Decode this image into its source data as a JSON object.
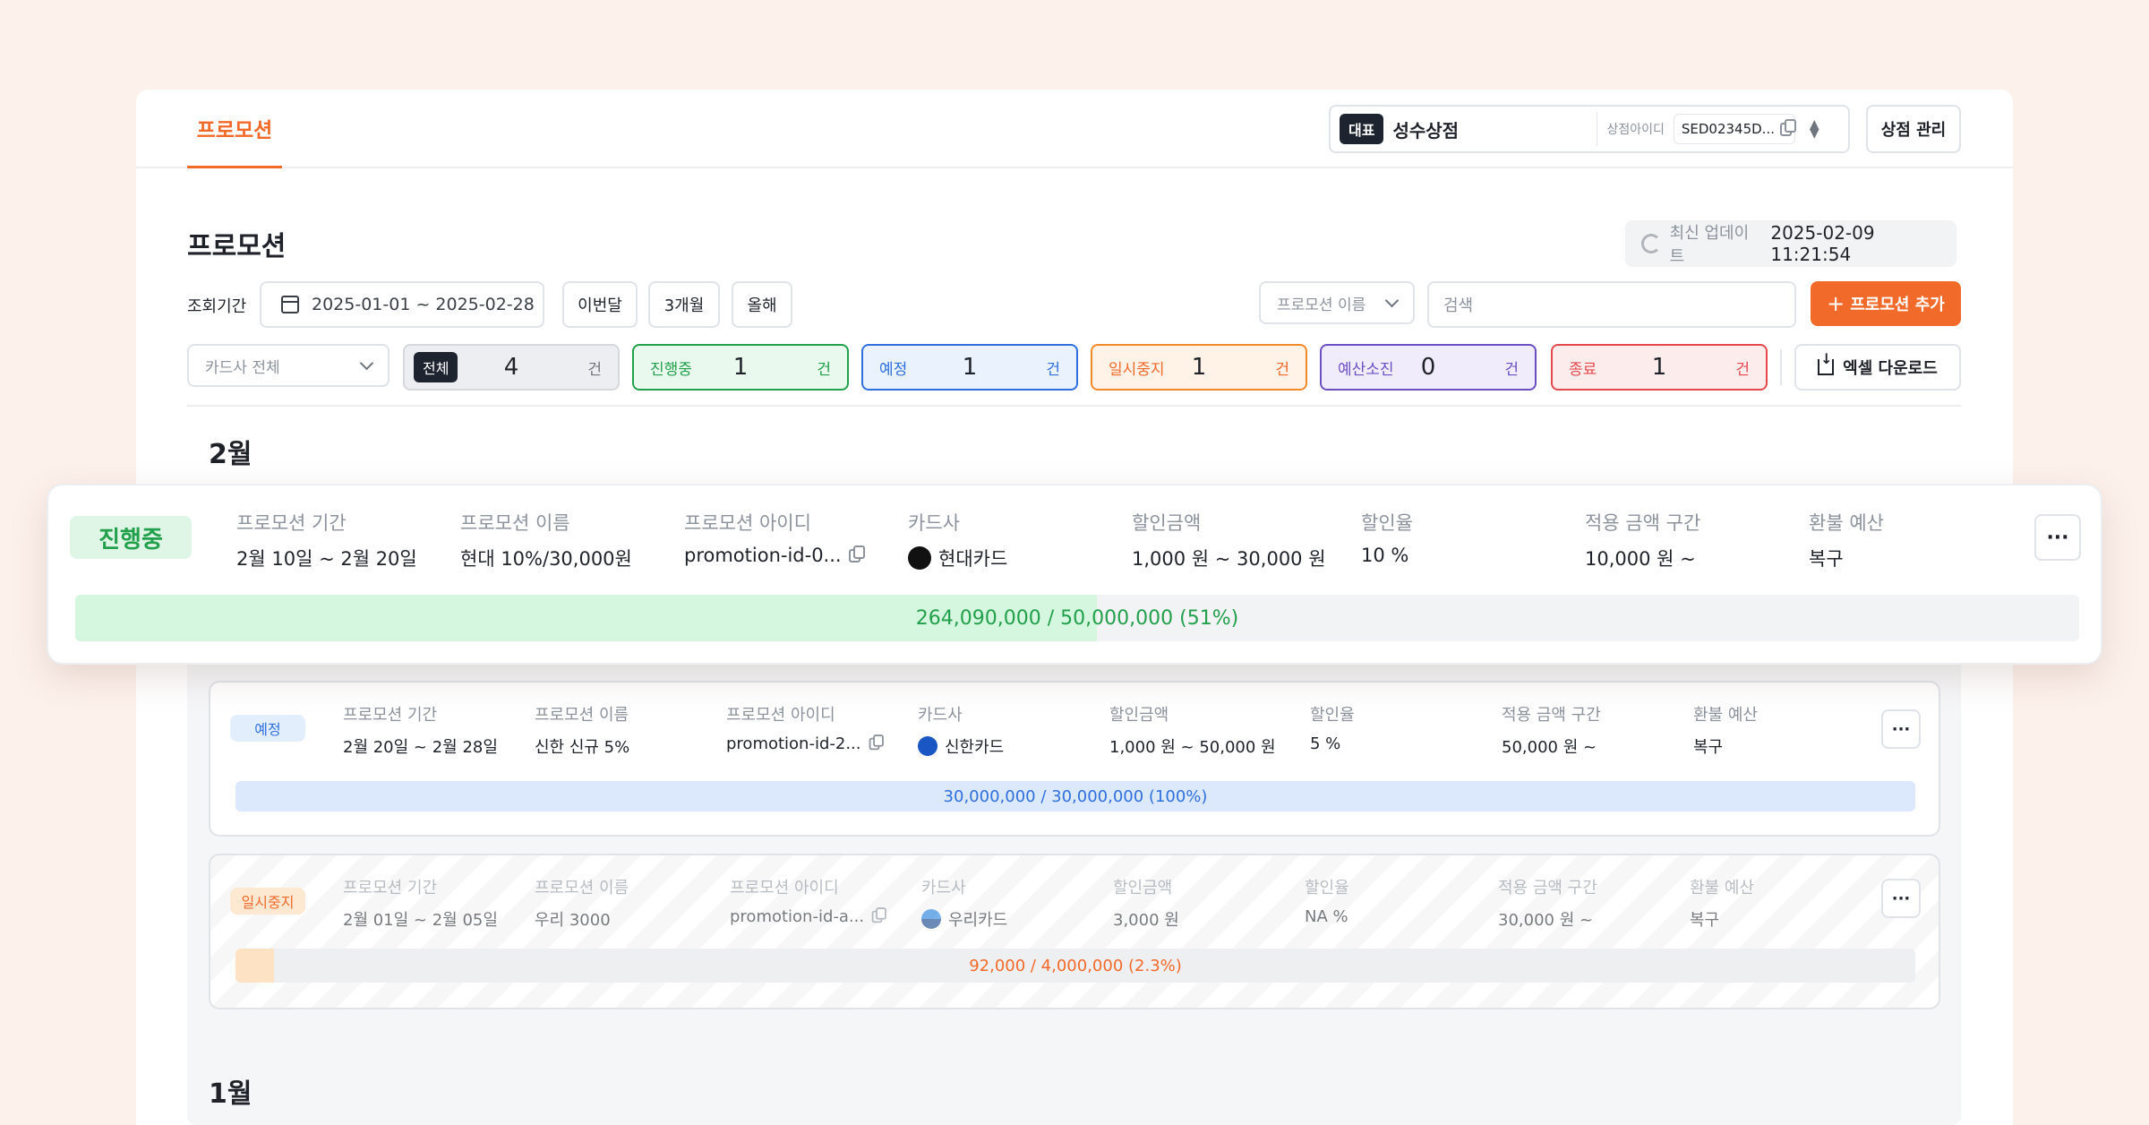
{
  "tab": {
    "active": "프로모션"
  },
  "store": {
    "badge": "대표",
    "name": "성수상점",
    "id_label": "상점아이디",
    "id": "SED02345D...",
    "manage_button": "상점 관리"
  },
  "page": {
    "title": "프로모션",
    "updated_label": "최신 업데이트",
    "updated_value": "2025-02-09 11:21:54"
  },
  "filters": {
    "period_label": "조회기간",
    "date_range": "2025-01-01 ~ 2025-02-28",
    "quick": [
      "이번달",
      "3개월",
      "올해"
    ],
    "name_select": "프로모션 이름",
    "search_placeholder": "검색",
    "add_button": "프로모션 추가",
    "card_select": "카드사 전체",
    "excel_button": "엑셀 다운로드"
  },
  "status_chips": [
    {
      "label": "전체",
      "count": "4",
      "unit": "건"
    },
    {
      "label": "진행중",
      "count": "1",
      "unit": "건"
    },
    {
      "label": "예정",
      "count": "1",
      "unit": "건"
    },
    {
      "label": "일시중지",
      "count": "1",
      "unit": "건"
    },
    {
      "label": "예산소진",
      "count": "0",
      "unit": "건"
    },
    {
      "label": "종료",
      "count": "1",
      "unit": "건"
    }
  ],
  "columns": [
    "프로모션 기간",
    "프로모션 이름",
    "프로모션 아이디",
    "카드사",
    "할인금액",
    "할인율",
    "적용 금액 구간",
    "환불 예산"
  ],
  "months": [
    "2월",
    "1월"
  ],
  "promotions": [
    {
      "status": "진행중",
      "period": "2월 10일 ~ 2월 20일",
      "name": "현대 10%/30,000원",
      "id": "promotion-id-0...",
      "card": "현대카드",
      "discount": "1,000 원 ~ 30,000 원",
      "rate": "10 %",
      "range": "10,000 원 ~",
      "refund": "복구",
      "budget_text": "264,090,000 / 50,000,000",
      "budget_pct": "(51%)",
      "progress": 0.51
    },
    {
      "status": "예정",
      "period": "2월 20일 ~ 2월 28일",
      "name": "신한 신규 5%",
      "id": "promotion-id-2...",
      "card": "신한카드",
      "discount": "1,000 원 ~ 50,000 원",
      "rate": "5 %",
      "range": "50,000 원 ~",
      "refund": "복구",
      "budget_text": "30,000,000 / 30,000,000",
      "budget_pct": "(100%)",
      "progress": 1.0
    },
    {
      "status": "일시중지",
      "period": "2월 01일 ~ 2월 05일",
      "name": "우리 3000",
      "id": "promotion-id-a...",
      "card": "우리카드",
      "discount": "3,000 원",
      "rate": "NA %",
      "range": "30,000 원 ~",
      "refund": "복구",
      "budget_text": "92,000 / 4,000,000",
      "budget_pct": "(2.3%)",
      "progress": 0.023
    }
  ],
  "more_label": "···",
  "colors": {
    "accent": "#f26a2a",
    "active": "#22a04b",
    "scheduled": "#2f6fde",
    "paused": "#f28a2a",
    "exhausted": "#6b4fc4",
    "ended": "#e5484d"
  }
}
